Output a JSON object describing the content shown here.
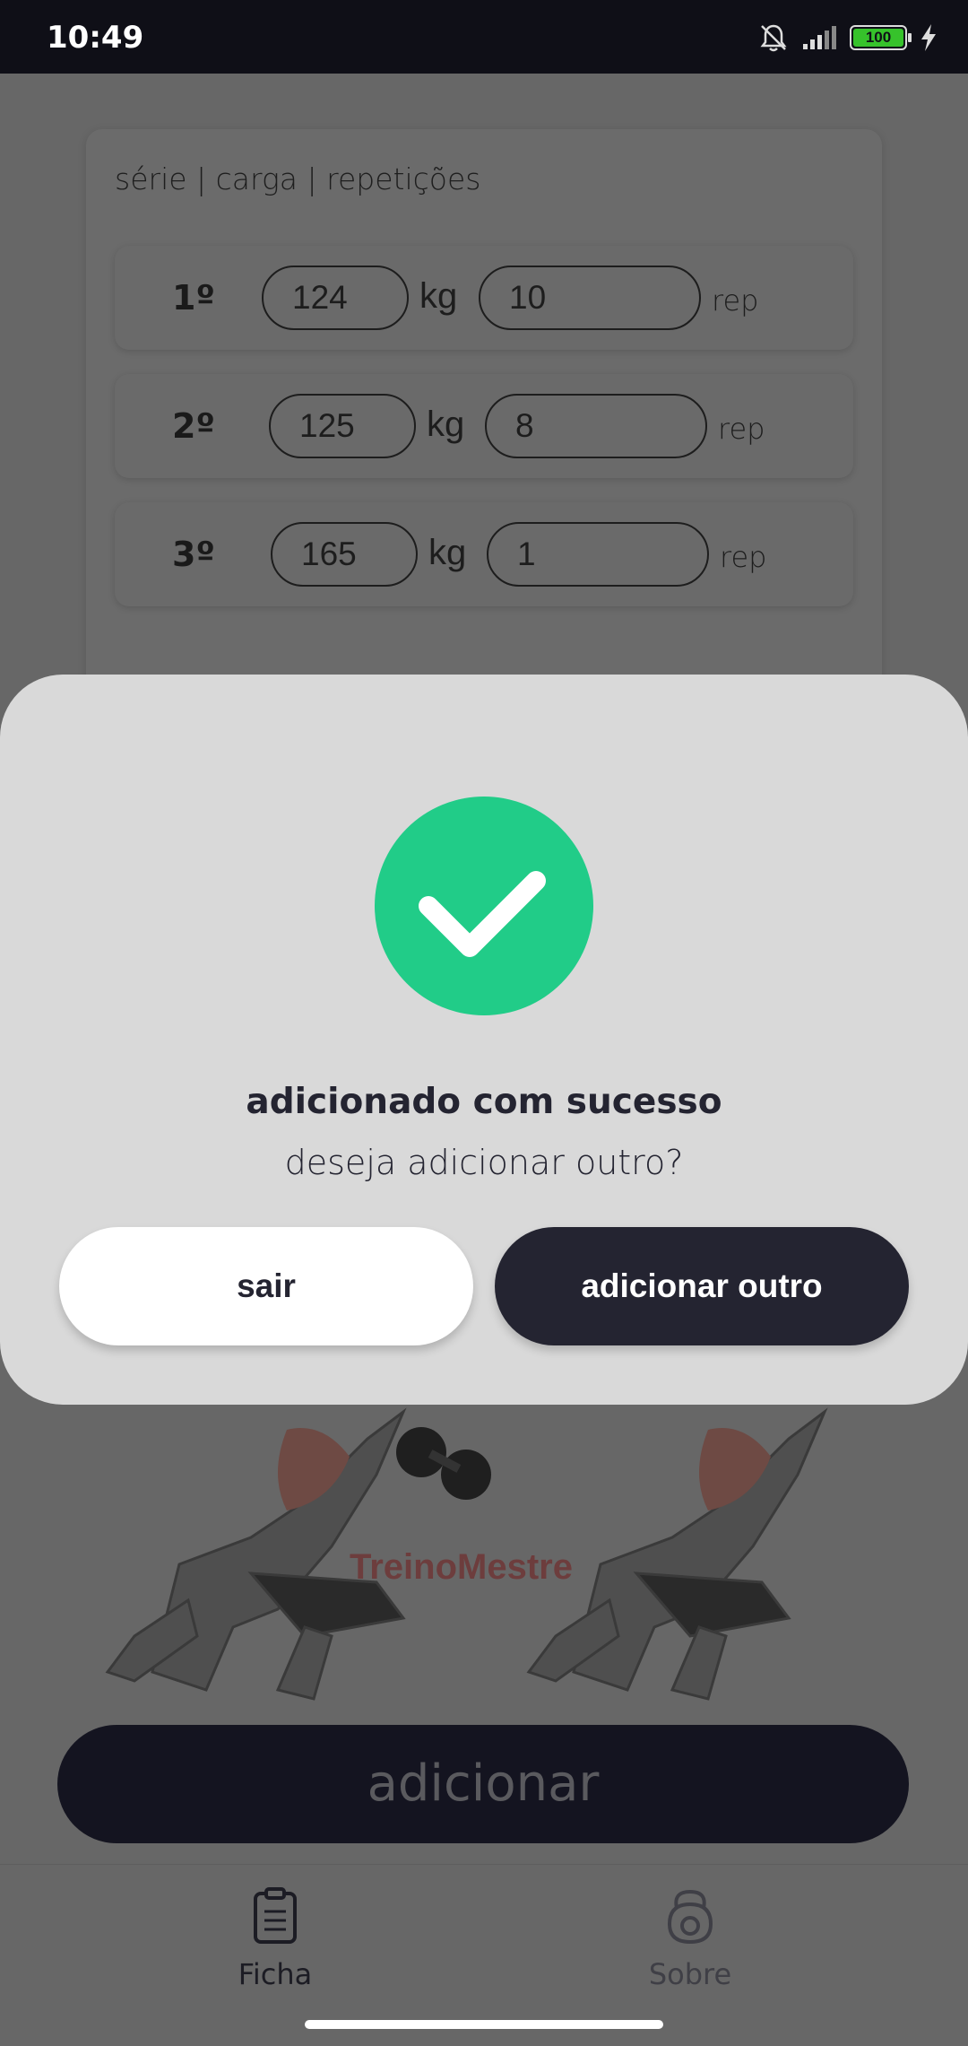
{
  "status_bar": {
    "time": "10:49",
    "battery": "100",
    "icons": [
      "bell-off-icon",
      "signal-icon",
      "battery-icon",
      "charging-icon"
    ]
  },
  "card": {
    "header": "série | carga | repetições",
    "rows": [
      {
        "num": "1º",
        "carga": "124",
        "kg_unit": "kg",
        "reps": "10",
        "rep_unit": "rep"
      },
      {
        "num": "2º",
        "carga": "125",
        "kg_unit": "kg",
        "reps": "8",
        "rep_unit": "rep"
      },
      {
        "num": "3º",
        "carga": "165",
        "kg_unit": "kg",
        "reps": "1",
        "rep_unit": "rep"
      }
    ]
  },
  "illustration": {
    "watermark": "TreinoMestre"
  },
  "add_button": {
    "label": "adicionar"
  },
  "modal": {
    "title": "adicionado com sucesso",
    "subtitle": "deseja adicionar outro?",
    "exit_label": "sair",
    "add_another_label": "adicionar outro",
    "success_color": "#21cc88"
  },
  "bottom_nav": {
    "items": [
      {
        "label": "Ficha",
        "icon": "clipboard-icon",
        "active": true
      },
      {
        "label": "Sobre",
        "icon": "kettlebell-icon",
        "active": false
      }
    ]
  }
}
